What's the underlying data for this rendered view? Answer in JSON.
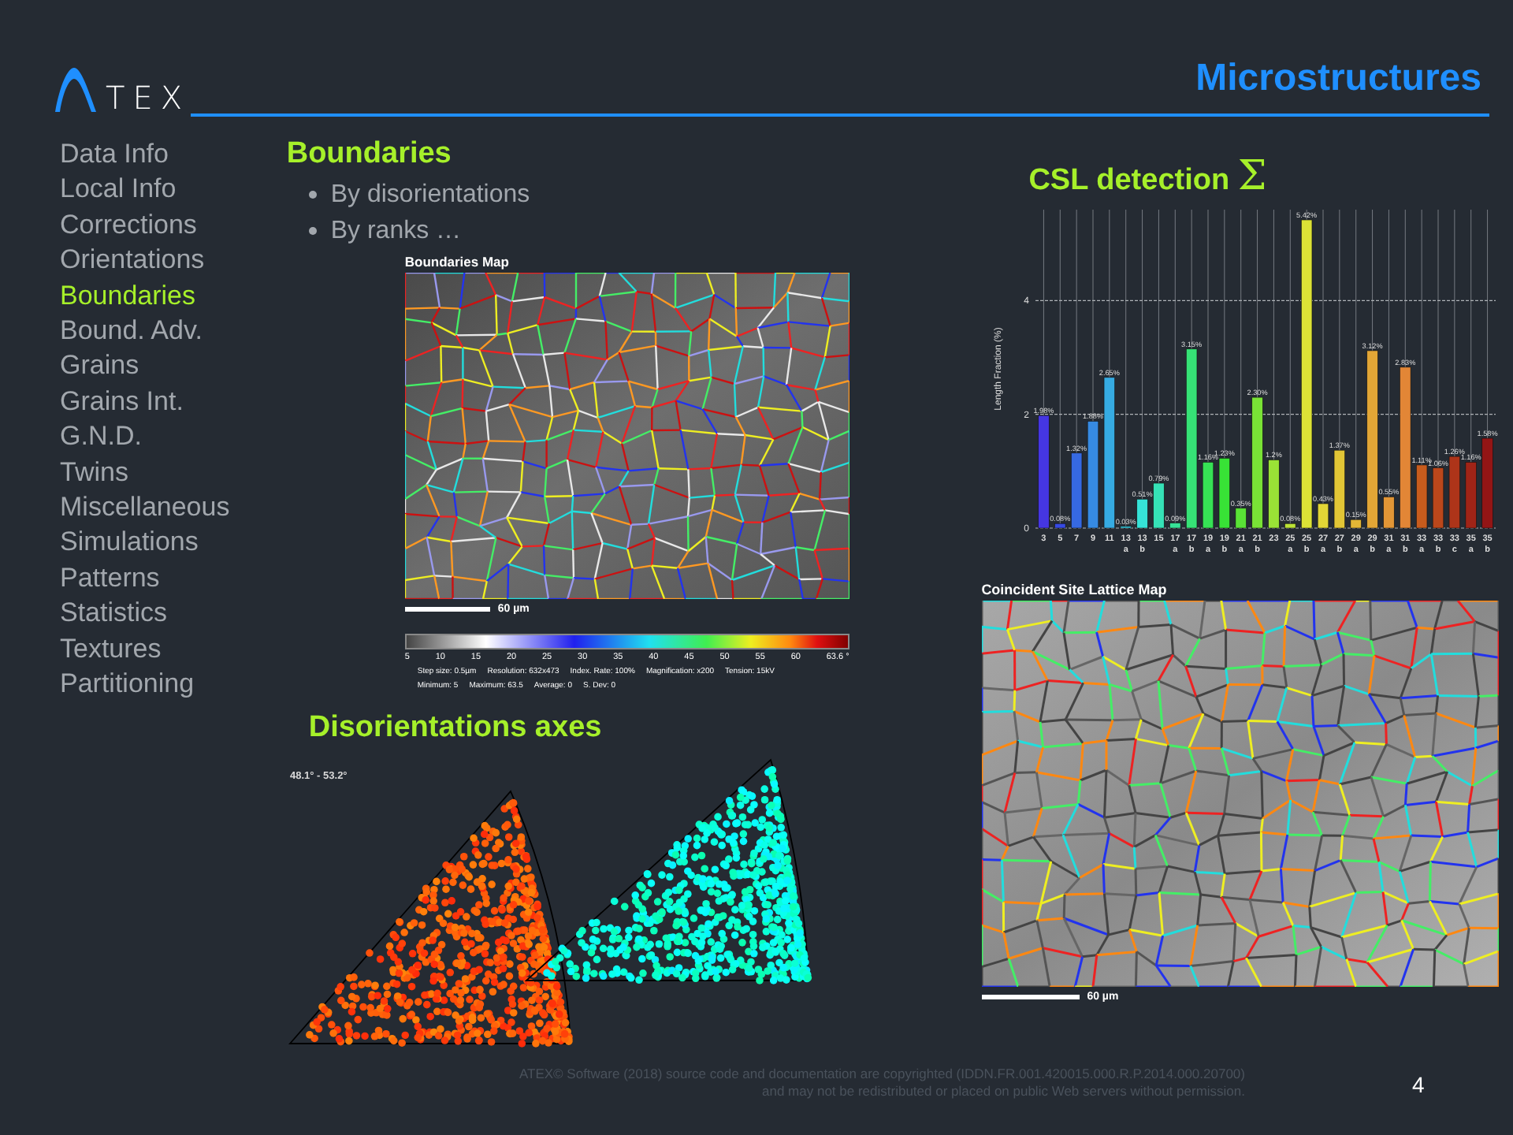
{
  "header": {
    "logo_text": "TEX",
    "title": "Microstructures"
  },
  "sidebar": {
    "items": [
      {
        "label": "Data Info",
        "selected": false
      },
      {
        "label": "Local Info",
        "selected": false
      },
      {
        "label": "Corrections",
        "selected": false
      },
      {
        "label": "Orientations",
        "selected": false
      },
      {
        "label": "Boundaries",
        "selected": true
      },
      {
        "label": "Bound. Adv.",
        "selected": false
      },
      {
        "label": "Grains",
        "selected": false
      },
      {
        "label": "Grains Int.",
        "selected": false
      },
      {
        "label": "G.N.D.",
        "selected": false
      },
      {
        "label": "Twins",
        "selected": false
      },
      {
        "label": "Miscellaneous",
        "selected": false
      },
      {
        "label": "Simulations",
        "selected": false
      },
      {
        "label": "Patterns",
        "selected": false
      },
      {
        "label": "Statistics",
        "selected": false
      },
      {
        "label": "Textures",
        "selected": false
      },
      {
        "label": "Partitioning",
        "selected": false
      }
    ]
  },
  "boundaries": {
    "heading": "Boundaries",
    "bullets": [
      "By disorientations",
      "By ranks …"
    ],
    "map": {
      "title": "Boundaries Map",
      "scale_label": "60 µm",
      "color_scale_ticks": [
        "5",
        "10",
        "15",
        "20",
        "25",
        "30",
        "35",
        "40",
        "45",
        "50",
        "55",
        "60",
        "63.6 °"
      ],
      "stats": [
        [
          "Step size: 0.5µm",
          "Resolution: 632x473",
          "Index. Rate: 100%",
          "Magnification: x200",
          "Tension: 15kV"
        ],
        [
          "Minimum: 5",
          "Maximum: 63.5",
          "Average: 0",
          "S. Dev: 0"
        ]
      ]
    }
  },
  "disorientations": {
    "heading": "Disorientations  axes",
    "range_label": "48.1° - 53.2°"
  },
  "csl": {
    "heading": "CSL detection",
    "symbol": "Σ",
    "chart_data": {
      "type": "bar",
      "ylabel": "Length Fraction (%)",
      "categories": [
        "3",
        "5",
        "7",
        "9",
        "11",
        "13 a",
        "13 b",
        "15",
        "17 a",
        "17 b",
        "19 a",
        "19 b",
        "21 a",
        "21 b",
        "23",
        "25 a",
        "25 b",
        "27 a",
        "27 b",
        "29 a",
        "29 b",
        "31 a",
        "31 b",
        "33 a",
        "33 b",
        "33 c",
        "35 a",
        "35 b"
      ],
      "grid": true,
      "series": [
        {
          "values": [
            1.98,
            0.08,
            1.32,
            1.88,
            2.65,
            0.03,
            0.51,
            0.79,
            0.09,
            3.15,
            1.16,
            1.23,
            0.35,
            2.3,
            1.2,
            0.08,
            5.42,
            0.43,
            1.37,
            0.15,
            3.12,
            0.55,
            2.83,
            1.11,
            1.06,
            1.26,
            1.16,
            1.58
          ]
        }
      ],
      "value_labels": [
        "1.98%",
        "0.08%",
        "1.32%",
        "1.88%",
        "2.65%",
        "0.03%",
        "0.51%",
        "0.79%",
        "0.09%",
        "3.15%",
        "1.16%",
        "1.23%",
        "0.35%",
        "2.30%",
        "1.2%",
        "0.08%",
        "5.42%",
        "0.43%",
        "1.37%",
        "0.15%",
        "3.12%",
        "0.55%",
        "2.83%",
        "1.11%",
        "1.06%",
        "1.26%",
        "1.16%",
        "1.58%"
      ],
      "ylim": [
        0,
        5.6
      ],
      "yticks": [
        0,
        2,
        4
      ]
    },
    "map": {
      "title": "Coincident Site Lattice Map",
      "scale_label": "60 µm"
    }
  },
  "footer": {
    "lines": [
      "ATEX© Software (2018) source code and documentation are copyrighted (IDDN.FR.001.420015.000.R.P.2014.000.20700)",
      "and may not be redistributed or placed on public Web servers without permission."
    ],
    "page_number": "4"
  }
}
